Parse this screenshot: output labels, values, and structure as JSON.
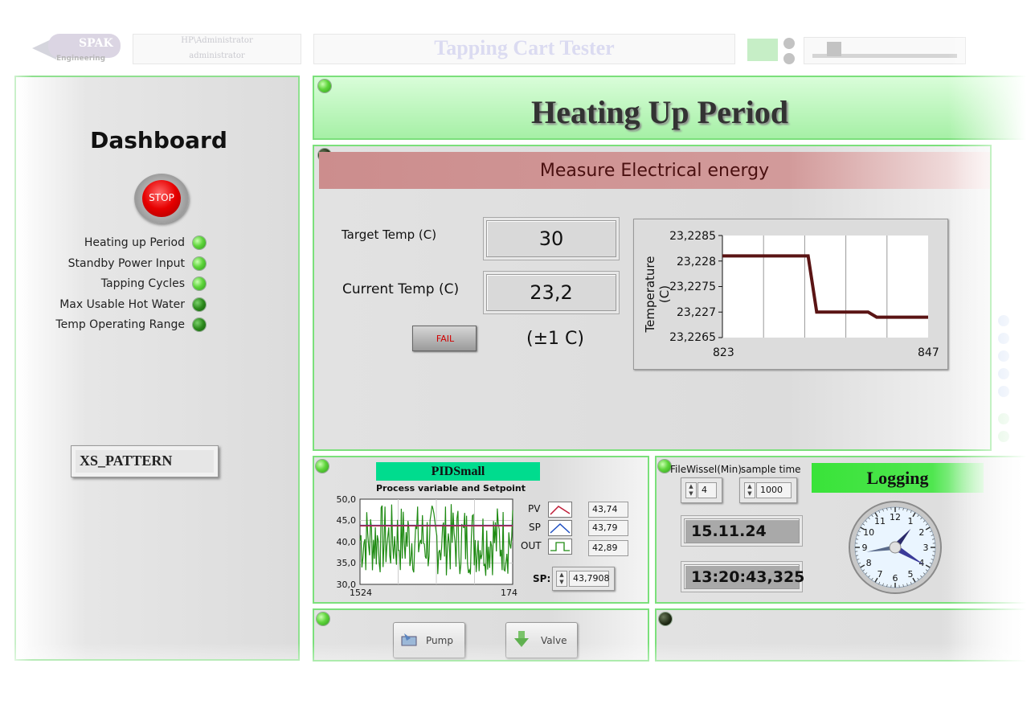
{
  "header": {
    "logo_text": "SPAK",
    "logo_sub": "Engineering",
    "user_line1": "HP\\Administrator",
    "user_line2": "administrator",
    "app_title": "Tapping Cart Tester"
  },
  "dashboard": {
    "title": "Dashboard",
    "stop_label": "STOP",
    "indicators": [
      {
        "label": "Heating up Period",
        "state": "on"
      },
      {
        "label": "Standby Power Input",
        "state": "on"
      },
      {
        "label": "Tapping Cycles",
        "state": "on"
      },
      {
        "label": "Max Usable Hot Water",
        "state": "dim"
      },
      {
        "label": "Temp Operating Range",
        "state": "dim"
      }
    ],
    "pattern_value": "XS_PATTERN"
  },
  "phase": {
    "title": "Heating Up Period"
  },
  "measure": {
    "title": "Measure Electrical energy",
    "target_label": "Target Temp (C)",
    "target_value": "30",
    "current_label": "Current Temp (C)",
    "current_value": "23,2",
    "fail_label": "FAIL",
    "tolerance": "(±1 C)"
  },
  "chart_data": {
    "type": "line",
    "ylabel": "Temperature (C)",
    "xlim": [
      823,
      847
    ],
    "ylim": [
      23.2265,
      23.2285
    ],
    "yticks": [
      "23,2285",
      "23,228",
      "23,2275",
      "23,227",
      "23,2265"
    ],
    "xticks": [
      "823",
      "847"
    ],
    "series": [
      {
        "x": [
          823,
          826,
          827,
          833,
          834,
          840,
          841,
          847
        ],
        "values": [
          23.2281,
          23.2281,
          23.2281,
          23.2281,
          23.227,
          23.227,
          23.2269,
          23.2269
        ]
      }
    ]
  },
  "pid": {
    "title": "PIDSmall",
    "subtitle": "Process variable and Setpoint",
    "yticks": [
      "50,0",
      "45,0",
      "40,0",
      "35,0",
      "30,0"
    ],
    "x_start": "1524",
    "x_end": "174",
    "legend": [
      {
        "name": "PV",
        "value": "43,74"
      },
      {
        "name": "SP",
        "value": "43,79"
      },
      {
        "name": "OUT",
        "value": "42,89"
      }
    ],
    "sp_label": "SP:",
    "sp_value": "43,7908",
    "colors": {
      "pv": "#c0203a",
      "sp": "#1f4fc2",
      "out": "#1e8a12"
    }
  },
  "logging": {
    "file_label": "FileWissel(Min)",
    "file_value": "4",
    "sample_label": "sample time",
    "sample_value": "1000",
    "title": "Logging",
    "date": "15.11.24",
    "time": "13:20:43,325",
    "clock_numbers": [
      "12",
      "1",
      "2",
      "3",
      "4",
      "5",
      "6",
      "7",
      "8",
      "9",
      "10",
      "11"
    ]
  },
  "controls": {
    "pump_label": "Pump",
    "valve_label": "Valve"
  }
}
